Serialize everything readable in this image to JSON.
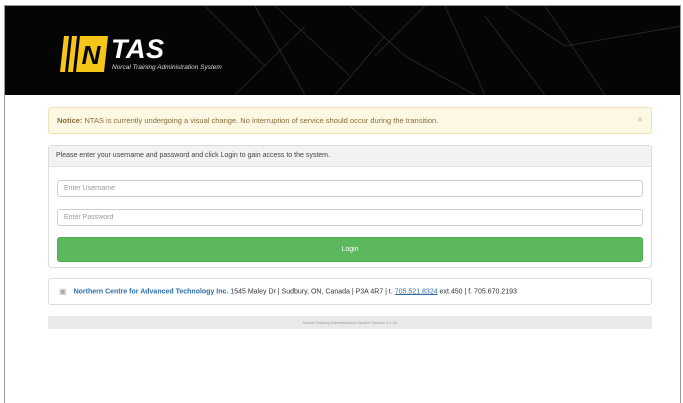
{
  "header": {
    "logo_text": "TAS",
    "logo_mark_letter": "N",
    "subtitle": "Norcal Training Administration System"
  },
  "notice": {
    "label": "Notice:",
    "message": "NTAS is currently undergoing a visual change. No interruption of service should occur during the transition.",
    "close": "×"
  },
  "login": {
    "instructions": "Please enter your username and password and click Login to gain access to the system.",
    "username_placeholder": "Enter Username",
    "password_placeholder": "Enter Password",
    "button_label": "Login"
  },
  "contact": {
    "icon": "building-icon",
    "org_name": "Northern Centre for Advanced Technology Inc.",
    "address": " 1545 Maley Dr | Sudbury, ON, Canada | P3A 4R7 | t. ",
    "phone": "705.521.8324",
    "phone_rest": " ext.450 | f. 705.670.2193"
  },
  "footer": {
    "version_text": "Norcal Training Administration System Version 3.1.44"
  },
  "colors": {
    "header_bg": "#050505",
    "logo_yellow": "#f5c518",
    "login_green": "#5cb85c",
    "notice_bg": "#fcf8e3",
    "link_blue": "#2f6fa8"
  }
}
